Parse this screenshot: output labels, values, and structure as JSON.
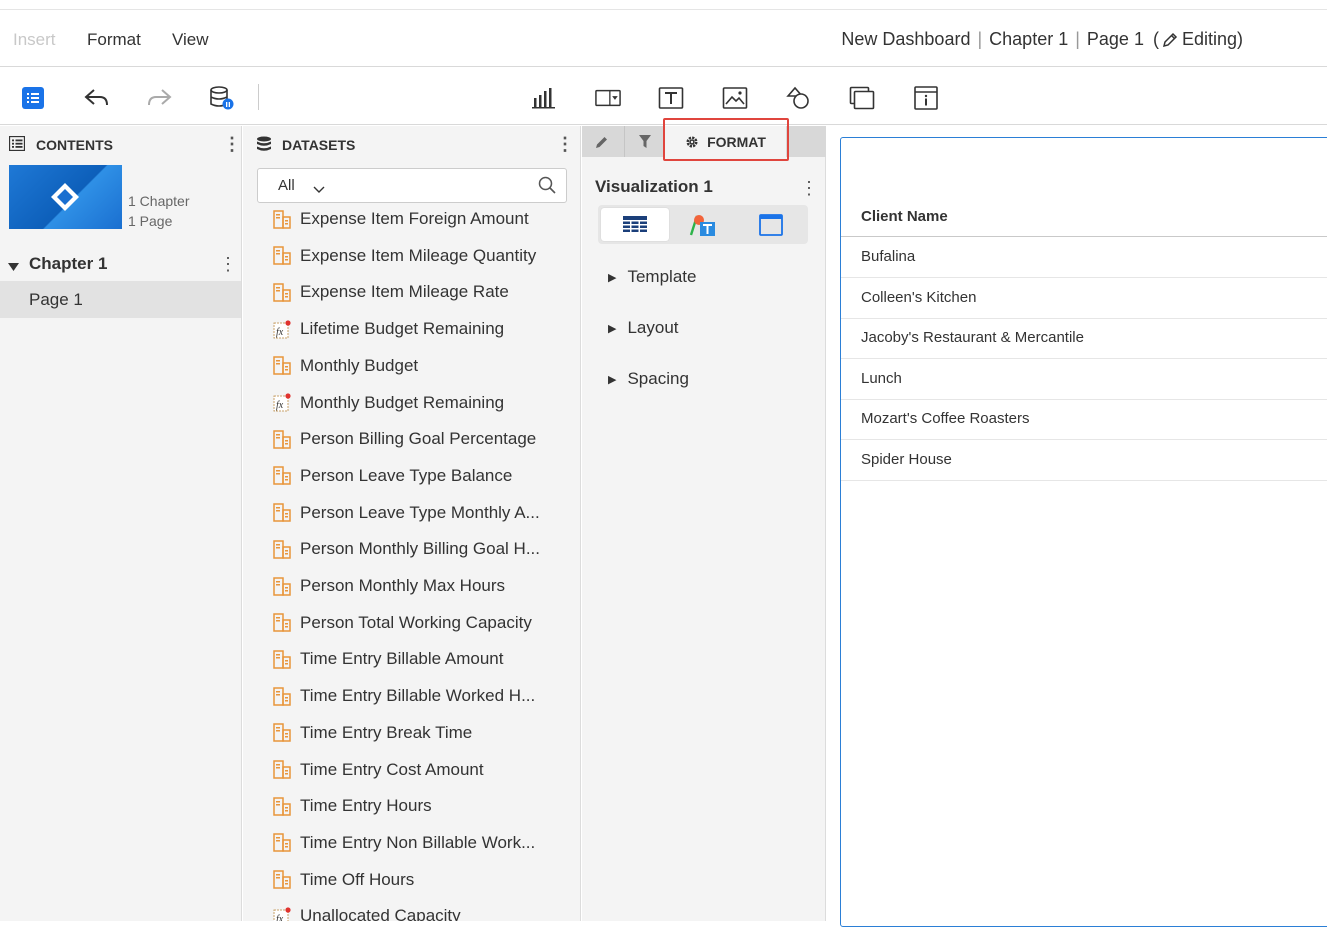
{
  "menu": {
    "insert": "Insert",
    "format": "Format",
    "view": "View"
  },
  "title": {
    "dashboard": "New Dashboard",
    "chapter": "Chapter 1",
    "page": "Page 1",
    "editing_open": "(",
    "editing": "Editing)"
  },
  "toolbar": {
    "icons": [
      "contents-toggle-icon",
      "undo-icon",
      "redo-icon",
      "data-source-icon",
      "chart-icon",
      "filter-control-icon",
      "text-box-icon",
      "image-icon",
      "shapes-icon",
      "copy-icon",
      "info-icon"
    ]
  },
  "contents": {
    "header": "CONTENTS",
    "chapter_count": "1 Chapter",
    "page_count": "1 Page",
    "chapter": "Chapter 1",
    "page": "Page 1"
  },
  "datasets": {
    "header": "DATASETS",
    "filter_value": "All",
    "items": [
      {
        "label": "Expense Item Foreign Amount",
        "type": "metric"
      },
      {
        "label": "Expense Item Mileage Quantity",
        "type": "metric"
      },
      {
        "label": "Expense Item Mileage Rate",
        "type": "metric"
      },
      {
        "label": "Lifetime Budget Remaining",
        "type": "derived"
      },
      {
        "label": "Monthly Budget",
        "type": "metric"
      },
      {
        "label": "Monthly Budget Remaining",
        "type": "derived"
      },
      {
        "label": "Person Billing Goal Percentage",
        "type": "metric"
      },
      {
        "label": "Person Leave Type Balance",
        "type": "metric"
      },
      {
        "label": "Person Leave Type Monthly A...",
        "type": "metric"
      },
      {
        "label": "Person Monthly Billing Goal H...",
        "type": "metric"
      },
      {
        "label": "Person Monthly Max Hours",
        "type": "metric"
      },
      {
        "label": "Person Total Working Capacity",
        "type": "metric"
      },
      {
        "label": "Time Entry Billable Amount",
        "type": "metric"
      },
      {
        "label": "Time Entry Billable Worked H...",
        "type": "metric"
      },
      {
        "label": "Time Entry Break Time",
        "type": "metric"
      },
      {
        "label": "Time Entry Cost Amount",
        "type": "metric"
      },
      {
        "label": "Time Entry Hours",
        "type": "metric"
      },
      {
        "label": "Time Entry Non Billable Work...",
        "type": "metric"
      },
      {
        "label": "Time Off Hours",
        "type": "metric"
      },
      {
        "label": "Unallocated Capacity",
        "type": "derived"
      }
    ]
  },
  "format_panel": {
    "format_tab": "FORMAT",
    "viz_title": "Visualization 1",
    "sections": [
      "Template",
      "Layout",
      "Spacing"
    ]
  },
  "table": {
    "header": "Client Name",
    "rows": [
      "Bufalina",
      "Colleen's Kitchen",
      "Jacoby's Restaurant & Mercantile",
      "Lunch",
      "Mozart's Coffee Roasters",
      "Spider House"
    ]
  },
  "colors": {
    "accent_blue": "#1a73e8",
    "highlight_red": "#e0453d",
    "metric_icon_orange": "#e8953a"
  }
}
